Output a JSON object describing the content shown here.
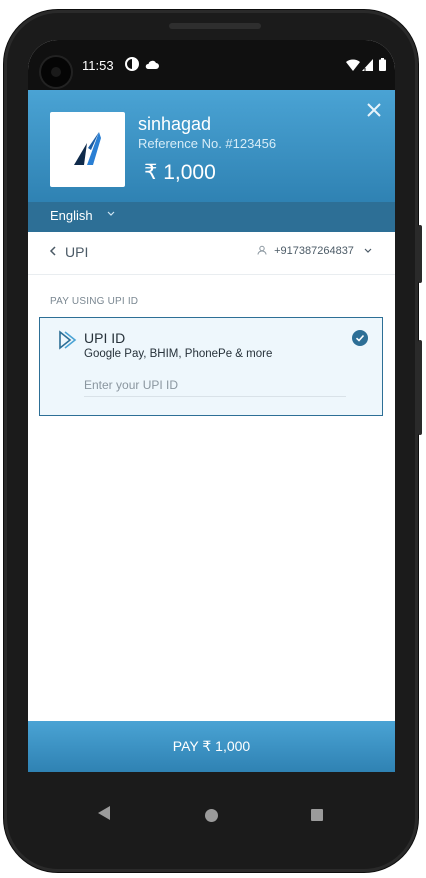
{
  "status_bar": {
    "time": "11:53",
    "icons": [
      "data-saver-icon",
      "cloud-icon",
      "wifi-icon",
      "signal-icon",
      "battery-icon"
    ]
  },
  "header": {
    "merchant_name": "sinhagad",
    "reference": "Reference No. #123456",
    "amount": "₹ 1,000",
    "logo_icon": "merchant-logo",
    "close_icon": "close-icon"
  },
  "language": {
    "selected": "English"
  },
  "nav": {
    "title": "UPI",
    "contact": "+917387264837"
  },
  "upi_section": {
    "label": "PAY USING UPI ID",
    "option_title": "UPI ID",
    "option_subtitle": "Google Pay, BHIM, PhonePe & more",
    "input_placeholder": "Enter your UPI ID",
    "input_value": ""
  },
  "pay_button": {
    "label": "PAY ₹ 1,000"
  },
  "colors": {
    "primary": "#2f82b3",
    "header_light": "#4aa3d4",
    "lang_bar": "#2d6f96",
    "card_bg": "#eef7fc"
  }
}
